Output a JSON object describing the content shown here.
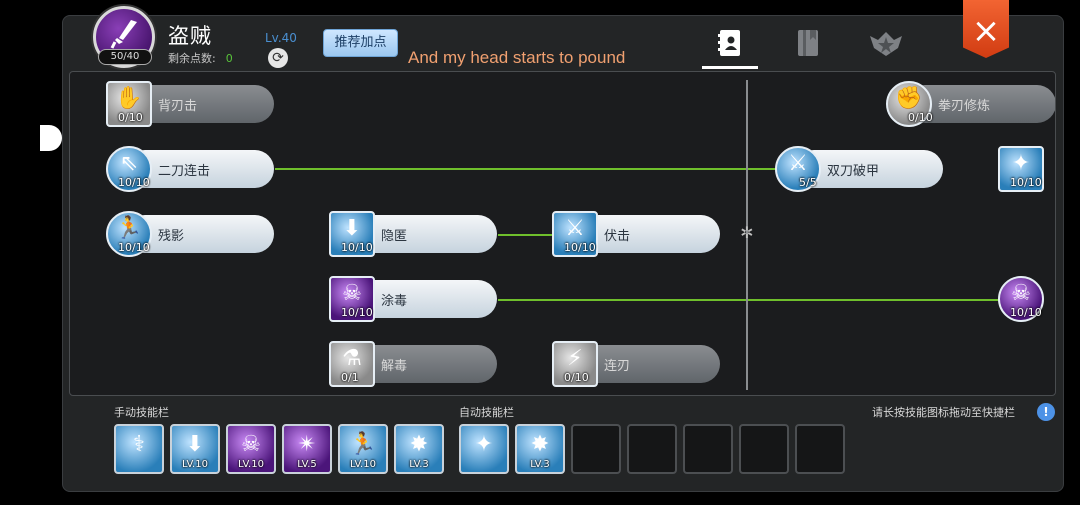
{
  "header": {
    "avatar_pill": "50/40",
    "class_name": "盗贼",
    "points_label": "剩余点数:",
    "points_value": "0",
    "level": "Lv.40",
    "recommend_label": "推荐加点",
    "subtitle": "And my head starts to pound"
  },
  "tabs": [
    {
      "icon": "skill-book-icon",
      "active": true
    },
    {
      "icon": "notebook-icon",
      "active": false
    },
    {
      "icon": "emblem-icon",
      "active": false
    }
  ],
  "tree": {
    "skills": [
      {
        "name": "背刃击",
        "level": "0/10",
        "locked": true
      },
      {
        "name": "二刀连击",
        "level": "10/10",
        "locked": false
      },
      {
        "name": "残影",
        "level": "10/10",
        "locked": false
      },
      {
        "name": "隐匿",
        "level": "10/10",
        "locked": false
      },
      {
        "name": "伏击",
        "level": "10/10",
        "locked": false
      },
      {
        "name": "涂毒",
        "level": "10/10",
        "locked": false
      },
      {
        "name": "解毒",
        "level": "0/1",
        "locked": true
      },
      {
        "name": "连刃",
        "level": "0/10",
        "locked": true
      },
      {
        "name": "双刀破甲",
        "level": "5/5",
        "locked": false
      },
      {
        "name": "拳刃修炼",
        "level": "0/10",
        "locked": true
      },
      {
        "name": "",
        "level": "10/10",
        "locked": false
      },
      {
        "name": "",
        "level": "10/10",
        "locked": false
      }
    ]
  },
  "manual_bar": {
    "title": "手动技能栏",
    "slots": [
      {
        "level": ""
      },
      {
        "level": "LV.10"
      },
      {
        "level": "LV.10"
      },
      {
        "level": "LV.5"
      },
      {
        "level": "LV.10"
      },
      {
        "level": "LV.3"
      }
    ]
  },
  "auto_bar": {
    "title": "自动技能栏",
    "slots": [
      {
        "level": ""
      },
      {
        "level": "LV.3"
      },
      {
        "level": ""
      },
      {
        "level": ""
      },
      {
        "level": ""
      },
      {
        "level": ""
      },
      {
        "level": ""
      }
    ]
  },
  "hint": "请长按技能图标拖动至快捷栏",
  "colors": {
    "accent_blue": "#4a8fd0",
    "link_green": "#6fbf2c",
    "close_orange": "#e4501f",
    "points_green": "#58c33a"
  }
}
